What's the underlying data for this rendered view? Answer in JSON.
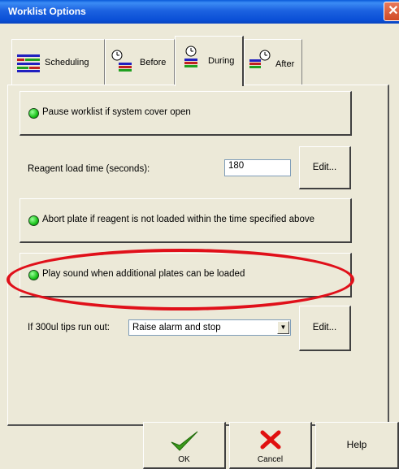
{
  "window": {
    "title": "Worklist Options",
    "close_glyph": "✕"
  },
  "tabs": [
    {
      "label": "Scheduling",
      "icon": "scheduling-icon"
    },
    {
      "label": "Before",
      "icon": "clock-before-icon"
    },
    {
      "label": "During",
      "icon": "clock-during-icon",
      "active": true
    },
    {
      "label": "After",
      "icon": "clock-after-icon"
    }
  ],
  "options": {
    "pause_label": "Pause worklist if system cover open",
    "reagent_label": "Reagent load time (seconds):",
    "reagent_value": "180",
    "reagent_edit": "Edit...",
    "abort_label": "Abort plate if reagent is not loaded within the time specified above",
    "sound_label": "Play sound when additional plates can be loaded",
    "tips_label": "If 300ul tips run out:",
    "tips_value": "Raise alarm and stop",
    "tips_edit": "Edit..."
  },
  "footer": {
    "ok": "OK",
    "cancel": "Cancel",
    "help": "Help"
  },
  "colors": {
    "led_on": "#1bc41b",
    "highlight": "#e0101a",
    "titlebar": "#0a4fd6"
  }
}
